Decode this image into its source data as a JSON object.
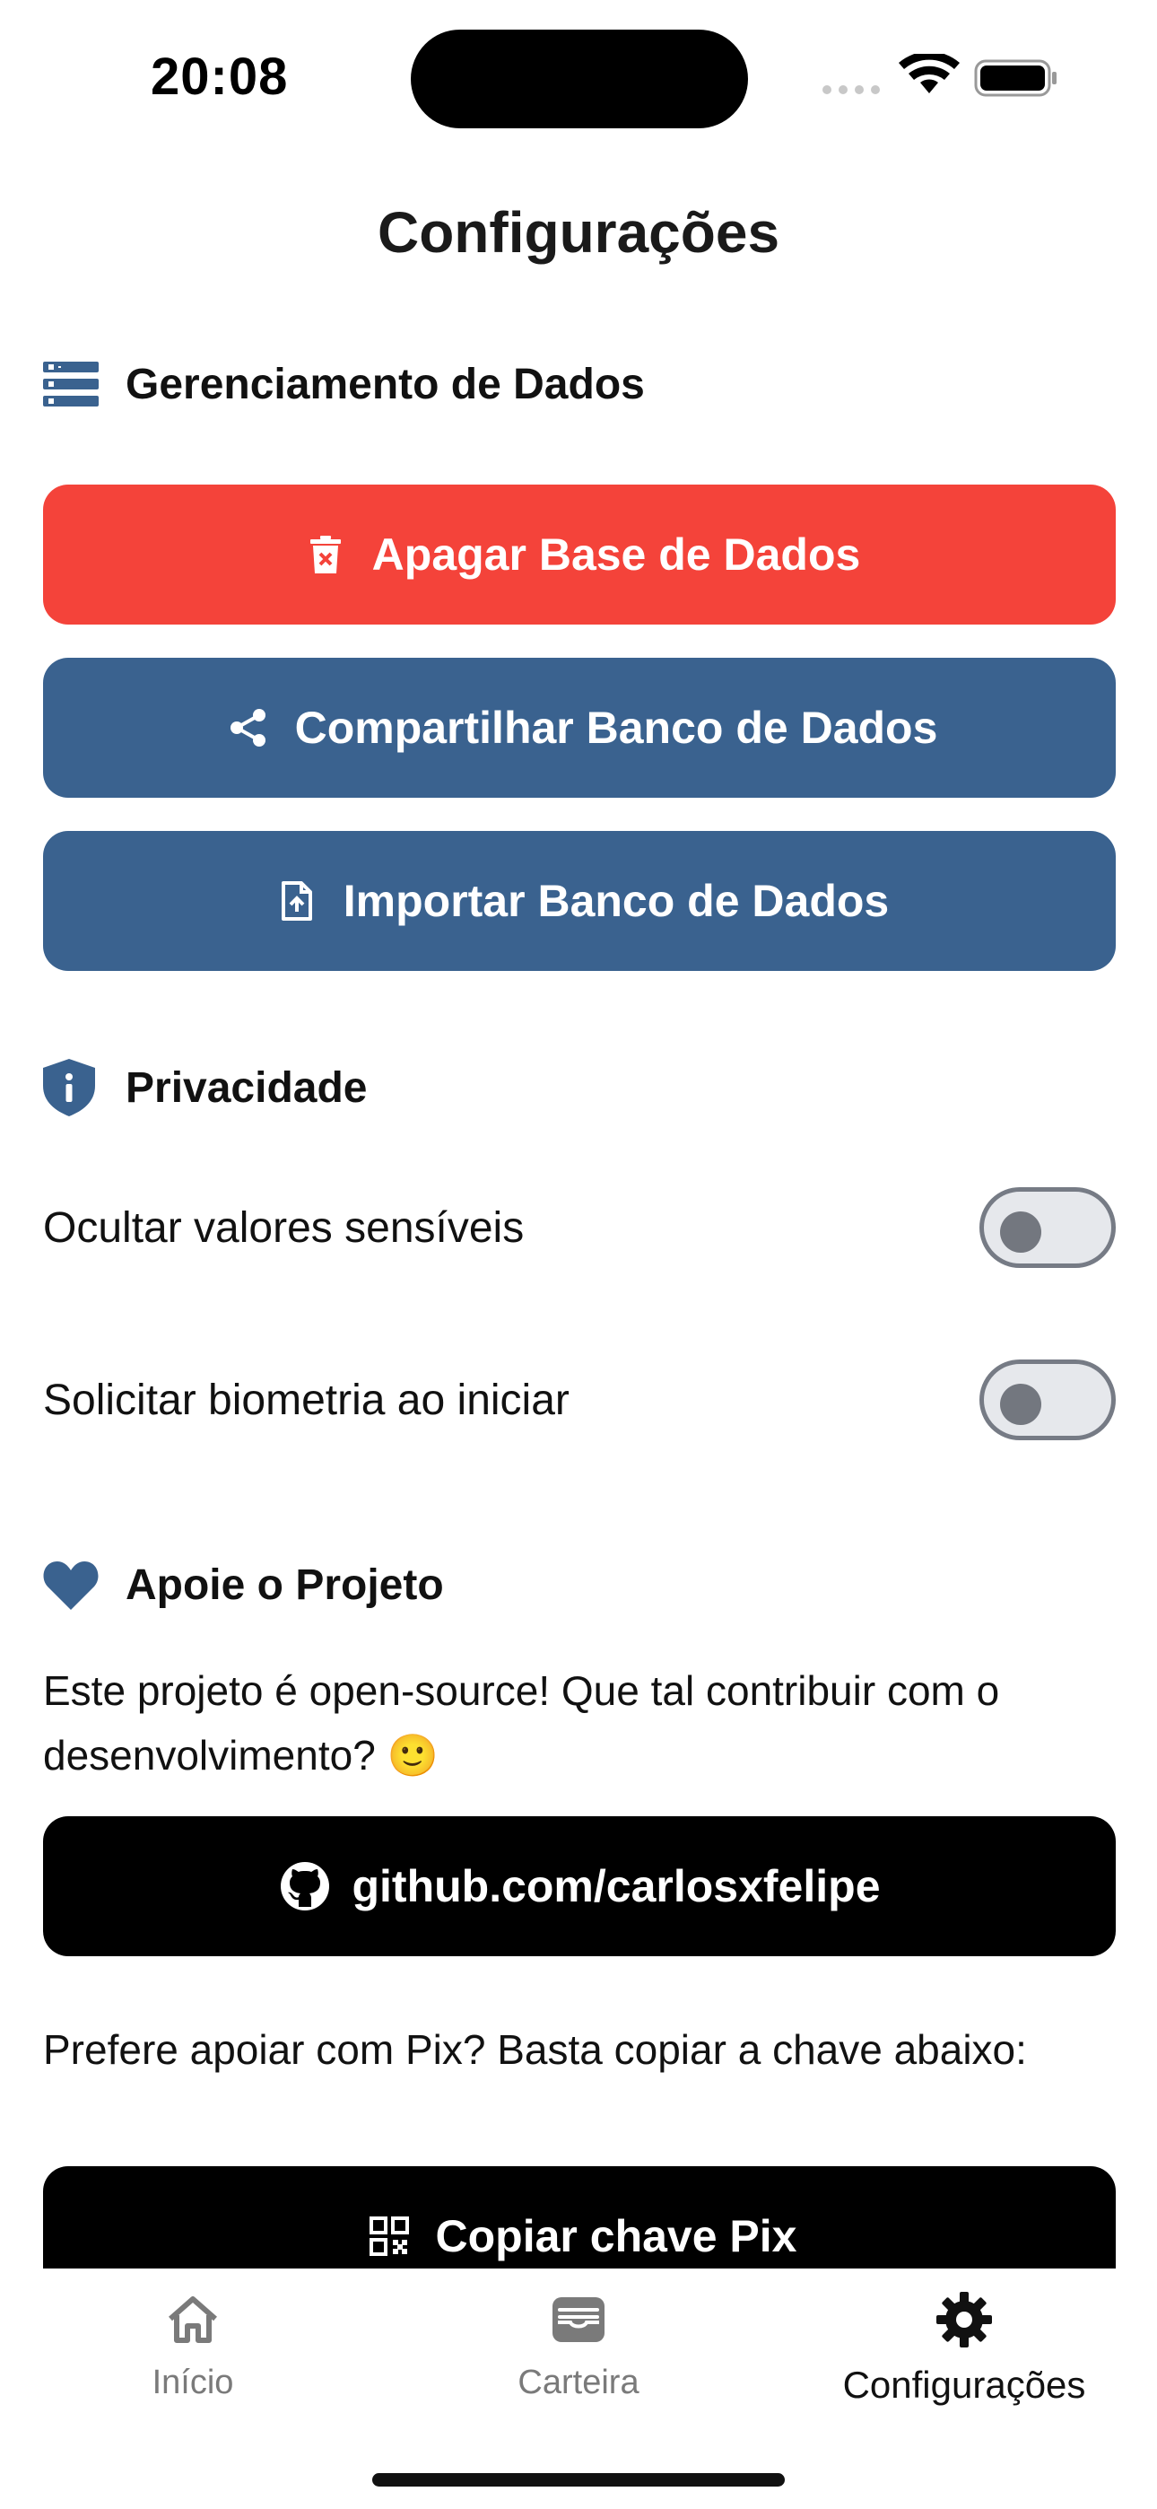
{
  "status_bar": {
    "time": "20:08"
  },
  "header": {
    "title": "Configurações"
  },
  "data_management": {
    "title": "Gerenciamento de Dados",
    "delete_label": "Apagar Base de Dados",
    "share_label": "Compartilhar Banco de Dados",
    "import_label": "Importar Banco de Dados"
  },
  "privacy": {
    "title": "Privacidade",
    "hide_values_label": "Ocultar valores sensíveis",
    "hide_values_on": false,
    "biometry_label": "Solicitar biometria ao iniciar",
    "biometry_on": false
  },
  "support": {
    "title": "Apoie o Projeto",
    "text": "Este projeto é open-source! Que tal contribuir com o desenvolvimento? 🙂",
    "github_label": "github.com/carlosxfelipe",
    "pix_text": "Prefere apoiar com Pix? Basta copiar a chave abaixo:",
    "pix_label": "Copiar chave Pix"
  },
  "tabs": [
    {
      "label": "Início",
      "icon": "home-icon",
      "active": false
    },
    {
      "label": "Carteira",
      "icon": "wallet-icon",
      "active": false
    },
    {
      "label": "Configurações",
      "icon": "gear-icon",
      "active": true
    }
  ],
  "colors": {
    "danger": "#f4433a",
    "primary": "#3a628f",
    "dark": "#000000",
    "accent_icon": "#3a628f"
  }
}
